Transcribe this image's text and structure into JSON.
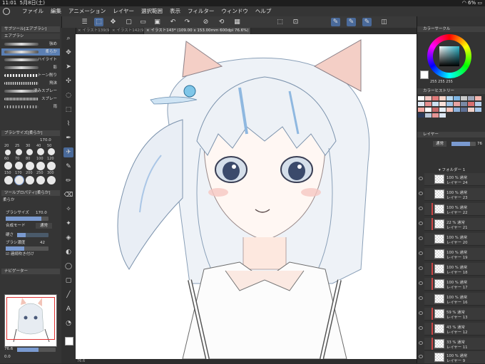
{
  "status": {
    "time": "11:01",
    "date": "5月8日(土)",
    "battery": "6%"
  },
  "menu": {
    "items": [
      "ファイル",
      "編集",
      "アニメーション",
      "レイヤー",
      "選択範囲",
      "表示",
      "フィルター",
      "ウィンドウ",
      "ヘルプ"
    ]
  },
  "tabs": [
    {
      "label": "イラスト139(9"
    },
    {
      "label": "イラスト142(9"
    },
    {
      "label": "イラスト143* (109.00 x 153.00mm 600dpi 76.6%)"
    }
  ],
  "subtool": {
    "header": "サブツール[エアブラシ]",
    "group": "エアブラシ",
    "brushes": [
      "強め",
      "柔らか",
      "ハイライト",
      "影",
      "トーン削り",
      "飛沫",
      "滲みスプレー",
      "スプレー",
      "雨"
    ]
  },
  "brushsize": {
    "header": "ブラシサイズ[柔らか]",
    "value": "170.0",
    "labels": [
      "20",
      "25",
      "30",
      "40",
      "50",
      "60",
      "70",
      "80",
      "100",
      "120",
      "150",
      "170",
      "200",
      "250",
      "300"
    ]
  },
  "toolprop": {
    "header": "ツールプロパティ[柔らか]",
    "name": "柔らか",
    "size_label": "ブラシサイズ",
    "size_value": "170.0",
    "blend_label": "合成モード",
    "blend_value": "通常",
    "hardness_label": "硬さ",
    "density_label": "ブラシ濃度",
    "density_value": "42",
    "continuous_label": "連続吹き付け"
  },
  "navigator": {
    "header": "ナビゲーター",
    "zoom": "76.6",
    "zoom_field": "0.0"
  },
  "color": {
    "header": "カラーサークル",
    "values": "255 255 255"
  },
  "history": {
    "header": "カラーヒストリー"
  },
  "layers": {
    "header": "レイヤー",
    "blend": "通常",
    "opacity": "76",
    "folder": "フォルダー 1",
    "rows": [
      {
        "pct": "100 %",
        "mode": "通常",
        "name": "レイヤー 24"
      },
      {
        "pct": "100 %",
        "mode": "通常",
        "name": "レイヤー 23"
      },
      {
        "pct": "100 %",
        "mode": "通常",
        "name": "レイヤー 22"
      },
      {
        "pct": "22 %",
        "mode": "通常",
        "name": "レイヤー 21"
      },
      {
        "pct": "100 %",
        "mode": "通常",
        "name": "レイヤー 20"
      },
      {
        "pct": "100 %",
        "mode": "通常",
        "name": "レイヤー 19"
      },
      {
        "pct": "100 %",
        "mode": "通常",
        "name": "レイヤー 18"
      },
      {
        "pct": "100 %",
        "mode": "通常",
        "name": "レイヤー 17"
      },
      {
        "pct": "100 %",
        "mode": "通常",
        "name": "レイヤー 16"
      },
      {
        "pct": "59 %",
        "mode": "通常",
        "name": "レイヤー 13"
      },
      {
        "pct": "43 %",
        "mode": "通常",
        "name": "レイヤー 12"
      },
      {
        "pct": "33 %",
        "mode": "通常",
        "name": "レイヤー 11"
      },
      {
        "pct": "100 %",
        "mode": "通常",
        "name": "レイヤー 9"
      }
    ]
  },
  "canvas_zoom": "76.6"
}
